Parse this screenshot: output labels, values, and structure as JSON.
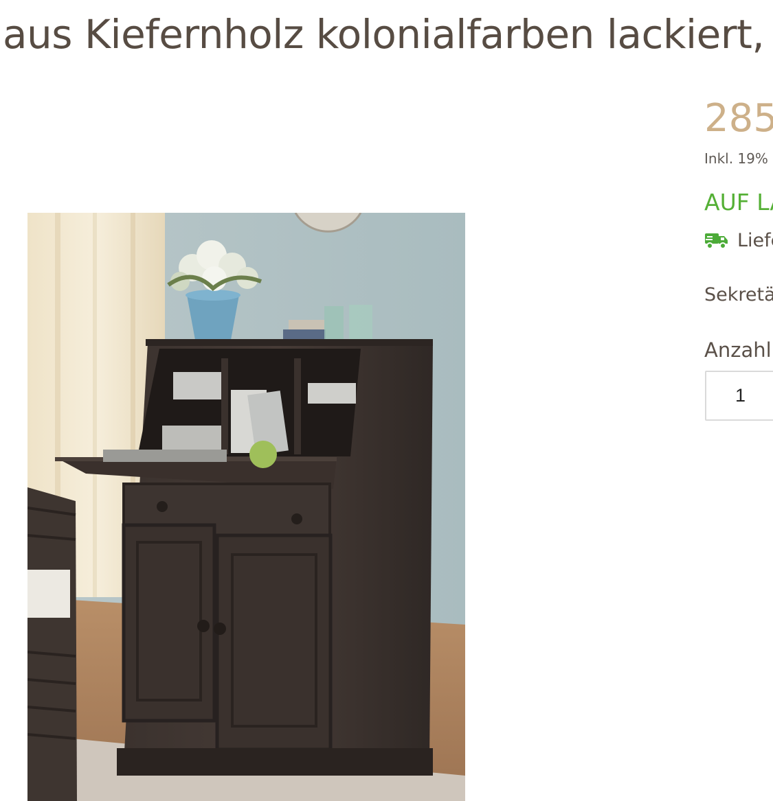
{
  "product": {
    "title": "aus Kiefernholz kolonialfarben lackiert,",
    "image_alt": "Sekretär aus Kiefernholz kolonialfarben lackiert"
  },
  "buy_box": {
    "price": "285",
    "tax_note": "Inkl. 19%",
    "stock_status": "AUF LA",
    "delivery_icon": "truck-icon",
    "delivery_text": "Liefe",
    "variant_text": "Sekretä",
    "quantity_label": "Anzahl",
    "quantity_value": "1"
  },
  "colors": {
    "title": "#574c43",
    "price": "#cdb089",
    "stock": "#55b036",
    "text": "#5a5048",
    "input_border": "#dadada"
  }
}
